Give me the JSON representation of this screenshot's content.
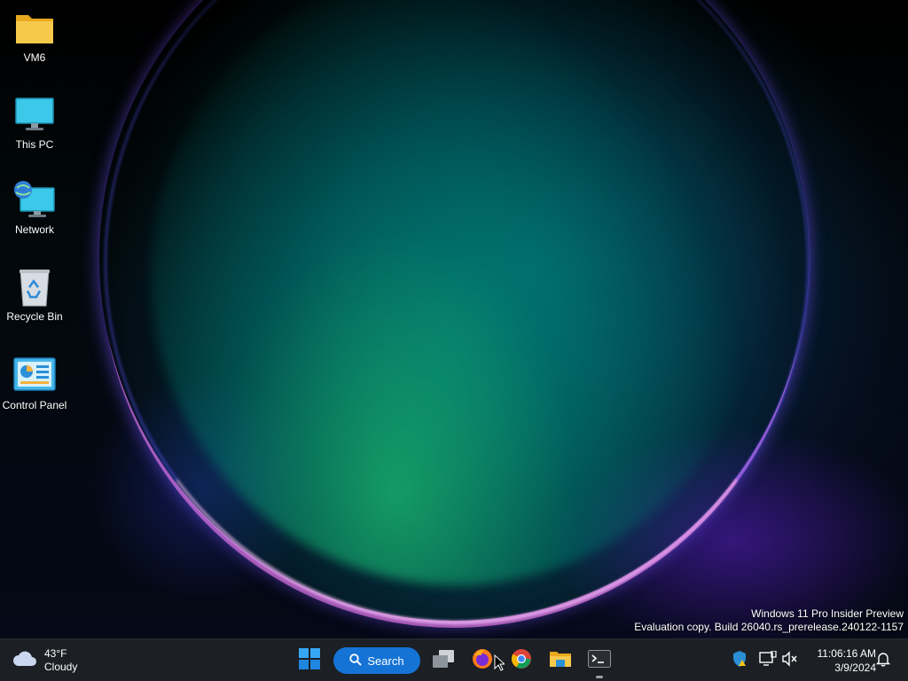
{
  "desktop": {
    "icons": [
      {
        "label": "VM6",
        "icon": "folder-icon"
      },
      {
        "label": "This PC",
        "icon": "monitor-icon"
      },
      {
        "label": "Network",
        "icon": "network-icon"
      },
      {
        "label": "Recycle Bin",
        "icon": "recycle-bin-icon"
      },
      {
        "label": "Control Panel",
        "icon": "control-panel-icon"
      }
    ],
    "watermark": {
      "line1": "Windows 11 Pro Insider Preview",
      "line2": "Evaluation copy. Build 26040.rs_prerelease.240122-1157"
    }
  },
  "taskbar": {
    "weather": {
      "temperature": "43°F",
      "condition": "Cloudy",
      "icon": "cloud-icon"
    },
    "start": {
      "icon": "windows-start-icon"
    },
    "search": {
      "label": "Search",
      "icon": "search-icon"
    },
    "pinned": [
      {
        "name": "task-view",
        "icon": "task-view-icon"
      },
      {
        "name": "firefox",
        "icon": "firefox-icon"
      },
      {
        "name": "chrome",
        "icon": "chrome-icon"
      },
      {
        "name": "file-explorer",
        "icon": "folder-icon"
      },
      {
        "name": "terminal",
        "icon": "terminal-icon",
        "running": true
      }
    ],
    "tray": {
      "icons": [
        "security-shield-warning-icon",
        "network-display-icon",
        "volume-muted-icon"
      ],
      "time": "11:06:16 AM",
      "date": "3/9/2024",
      "notification_icon": "bell-icon"
    }
  },
  "colors": {
    "taskbar_bg": "#1c1f24",
    "search_accent": "#1573d6"
  }
}
